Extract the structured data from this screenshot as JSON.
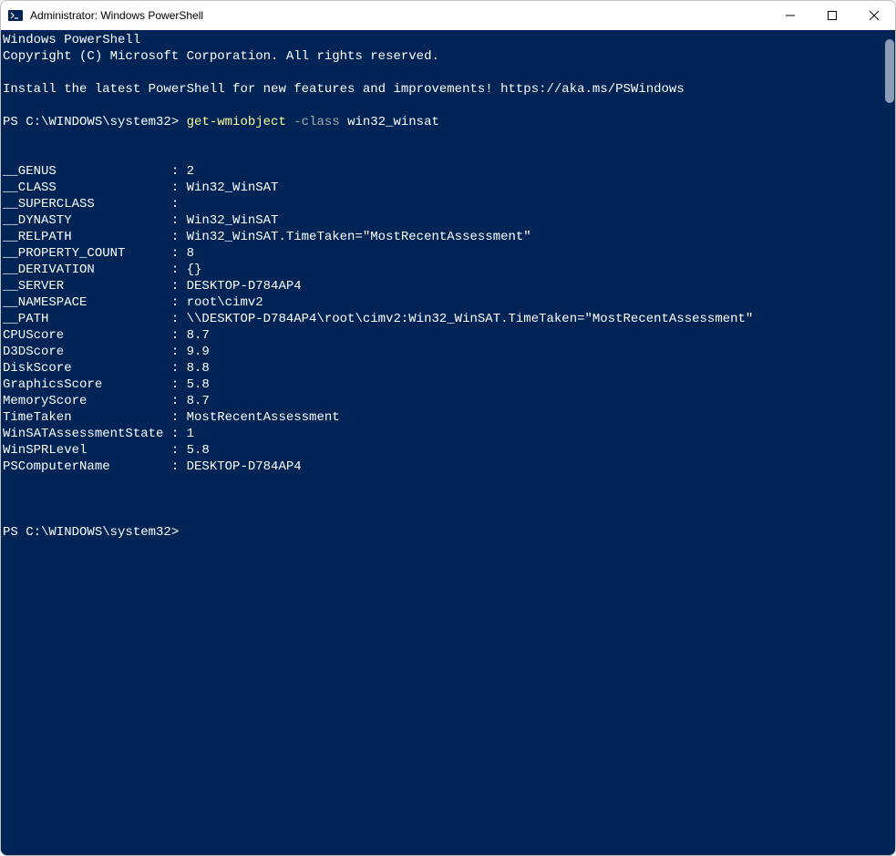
{
  "titlebar": {
    "title": "Administrator: Windows PowerShell"
  },
  "banner": {
    "line1": "Windows PowerShell",
    "line2": "Copyright (C) Microsoft Corporation. All rights reserved.",
    "line3": "Install the latest PowerShell for new features and improvements! https://aka.ms/PSWindows"
  },
  "prompt": {
    "path": "PS C:\\WINDOWS\\system32> ",
    "cmd": "get-wmiobject",
    "param": " -class",
    "arg": " win32_winsat"
  },
  "output": [
    {
      "key": "__GENUS               ",
      "value": "2"
    },
    {
      "key": "__CLASS               ",
      "value": "Win32_WinSAT"
    },
    {
      "key": "__SUPERCLASS          ",
      "value": ""
    },
    {
      "key": "__DYNASTY             ",
      "value": "Win32_WinSAT"
    },
    {
      "key": "__RELPATH             ",
      "value": "Win32_WinSAT.TimeTaken=\"MostRecentAssessment\""
    },
    {
      "key": "__PROPERTY_COUNT      ",
      "value": "8"
    },
    {
      "key": "__DERIVATION          ",
      "value": "{}"
    },
    {
      "key": "__SERVER              ",
      "value": "DESKTOP-D784AP4"
    },
    {
      "key": "__NAMESPACE           ",
      "value": "root\\cimv2"
    },
    {
      "key": "__PATH                ",
      "value": "\\\\DESKTOP-D784AP4\\root\\cimv2:Win32_WinSAT.TimeTaken=\"MostRecentAssessment\""
    },
    {
      "key": "CPUScore              ",
      "value": "8.7"
    },
    {
      "key": "D3DScore              ",
      "value": "9.9"
    },
    {
      "key": "DiskScore             ",
      "value": "8.8"
    },
    {
      "key": "GraphicsScore         ",
      "value": "5.8"
    },
    {
      "key": "MemoryScore           ",
      "value": "8.7"
    },
    {
      "key": "TimeTaken             ",
      "value": "MostRecentAssessment"
    },
    {
      "key": "WinSATAssessmentState ",
      "value": "1"
    },
    {
      "key": "WinSPRLevel           ",
      "value": "5.8"
    },
    {
      "key": "PSComputerName        ",
      "value": "DESKTOP-D784AP4"
    }
  ],
  "prompt2": {
    "path": "PS C:\\WINDOWS\\system32> "
  }
}
